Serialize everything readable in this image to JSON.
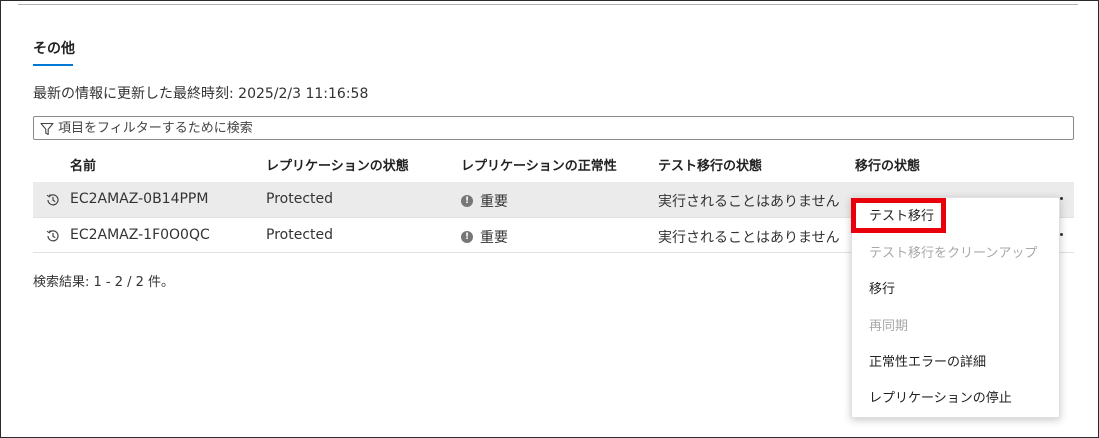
{
  "section": {
    "tab_label": "その他",
    "last_refresh": "最新の情報に更新した最終時刻: 2025/2/3 11:16:58"
  },
  "filter": {
    "placeholder": "項目をフィルターするために検索",
    "value": "",
    "icon": "filter-icon"
  },
  "table": {
    "columns": [
      "名前",
      "レプリケーションの状態",
      "レプリケーションの正常性",
      "テスト移行の状態",
      "移行の状態"
    ],
    "rows": [
      {
        "icon": "history-icon",
        "name": "EC2AMAZ-0B14PPM",
        "replication_status": "Protected",
        "health": "重要",
        "test_migration_status": "実行されることはありません",
        "migration_status": ""
      },
      {
        "icon": "history-icon",
        "name": "EC2AMAZ-1F0O0QC",
        "replication_status": "Protected",
        "health": "重要",
        "test_migration_status": "実行されることはありません",
        "migration_status": ""
      }
    ]
  },
  "results": "検索結果: 1 - 2 / 2 件。",
  "context_menu": {
    "items": [
      {
        "label": "テスト移行",
        "disabled": false
      },
      {
        "label": "テスト移行をクリーンアップ",
        "disabled": true
      },
      {
        "label": "移行",
        "disabled": false
      },
      {
        "label": "再同期",
        "disabled": true
      },
      {
        "label": "正常性エラーの詳細",
        "disabled": false
      },
      {
        "label": "レプリケーションの停止",
        "disabled": false
      }
    ]
  },
  "colors": {
    "accent": "#0078d4",
    "highlight": "#e8000b",
    "selected_row": "#ebebeb",
    "disabled_text": "#a8a8a8"
  }
}
